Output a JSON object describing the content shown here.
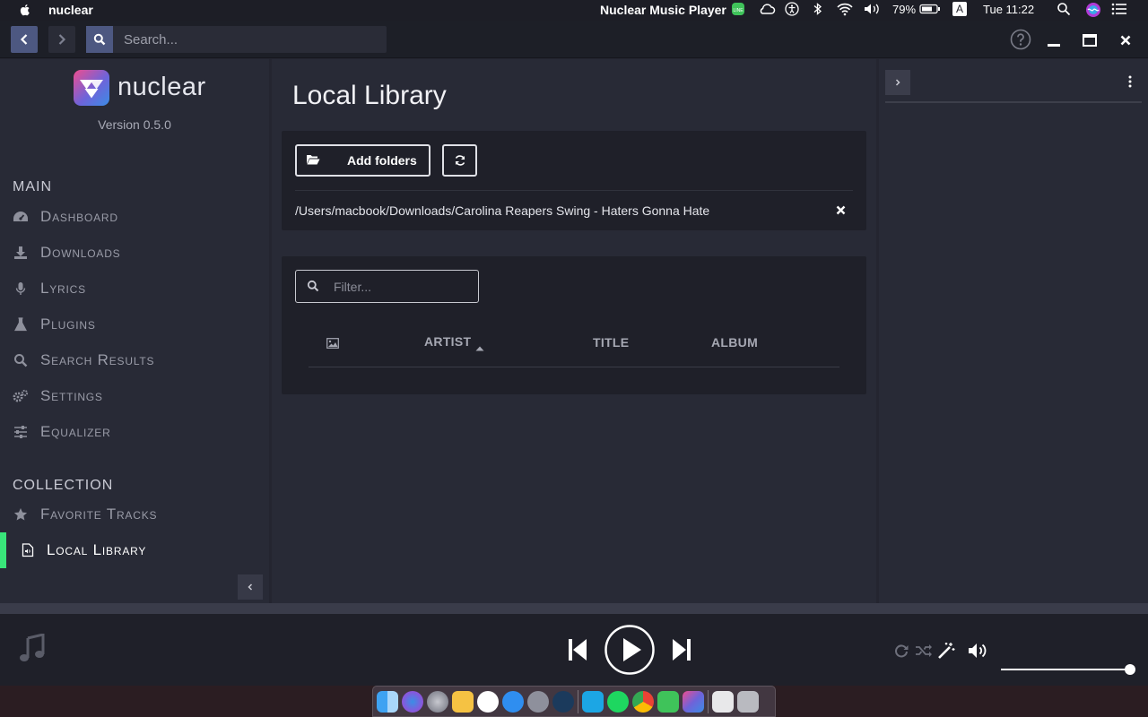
{
  "menubar": {
    "app_name": "nuclear",
    "window_title": "Nuclear Music Player",
    "battery": "79%",
    "input_source": "A",
    "clock": "Tue 11:22"
  },
  "topbar": {
    "search_placeholder": "Search..."
  },
  "sidebar": {
    "logo_text": "nuclear",
    "version": "Version 0.5.0",
    "main_heading": "MAIN",
    "main_items": [
      {
        "label": "Dashboard",
        "icon": "dashboard-icon"
      },
      {
        "label": "Downloads",
        "icon": "download-icon"
      },
      {
        "label": "Lyrics",
        "icon": "microphone-icon"
      },
      {
        "label": "Plugins",
        "icon": "flask-icon"
      },
      {
        "label": "Search Results",
        "icon": "search-icon"
      },
      {
        "label": "Settings",
        "icon": "gears-icon"
      },
      {
        "label": "Equalizer",
        "icon": "sliders-icon"
      }
    ],
    "collection_heading": "COLLECTION",
    "collection_items": [
      {
        "label": "Favorite Tracks",
        "icon": "star-icon"
      },
      {
        "label": "Local Library",
        "icon": "audio-file-icon",
        "active": true
      }
    ]
  },
  "main": {
    "title": "Local Library",
    "add_folders_label": "Add folders",
    "folder_path": "/Users/macbook/Downloads/Carolina Reapers Swing - Haters Gonna Hate",
    "filter_placeholder": "Filter...",
    "columns": [
      "ARTIST",
      "TITLE",
      "ALBUM"
    ],
    "sorted_column": "ARTIST"
  },
  "player": {
    "volume": 1.0
  },
  "colors": {
    "accent_active": "#39e57a",
    "background": "#242530",
    "panel": "#1f2029"
  }
}
